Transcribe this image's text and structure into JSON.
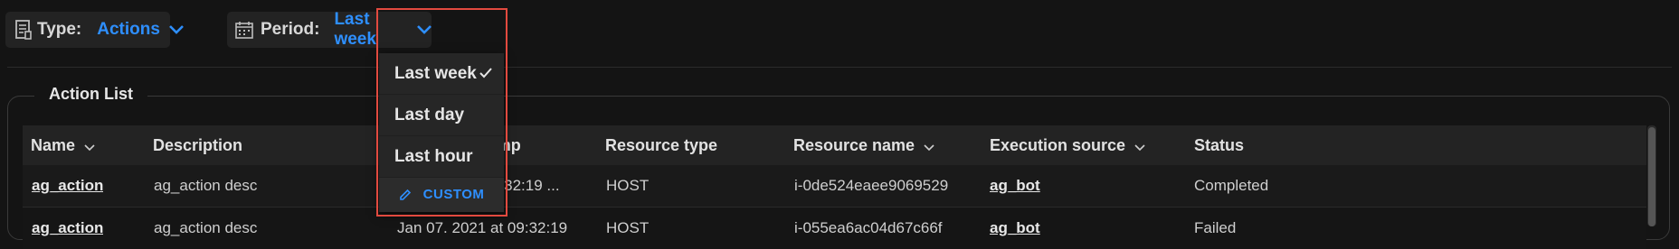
{
  "filters": {
    "type": {
      "label": "Type:",
      "value": "Actions"
    },
    "period": {
      "label": "Period:",
      "value": "Last week"
    }
  },
  "period_menu": {
    "options": [
      "Last week",
      "Last day",
      "Last hour"
    ],
    "selected": "Last week",
    "custom_label": "CUSTOM"
  },
  "section": {
    "title": "Action List"
  },
  "table": {
    "columns": [
      "Name",
      "Description",
      "Timestamp",
      "Resource type",
      "Resource name",
      "Execution source",
      "Status"
    ],
    "rows": [
      {
        "name": "ag_action",
        "description": "ag_action desc",
        "timestamp": "...7. 2021 at 09:32:19 ...",
        "resource_type": "HOST",
        "resource_name": "i-0de524eaee9069529",
        "execution_source": "ag_bot",
        "status": "Completed"
      },
      {
        "name": "ag_action",
        "description": "ag_action desc",
        "timestamp": "Jan 07. 2021 at 09:32:19",
        "resource_type": "HOST",
        "resource_name": "i-055ea6ac04d67c66f",
        "execution_source": "ag_bot",
        "status": "Failed"
      }
    ]
  },
  "colors": {
    "accent": "#2e8fff",
    "highlight": "#e24a3f",
    "background": "#141414"
  }
}
